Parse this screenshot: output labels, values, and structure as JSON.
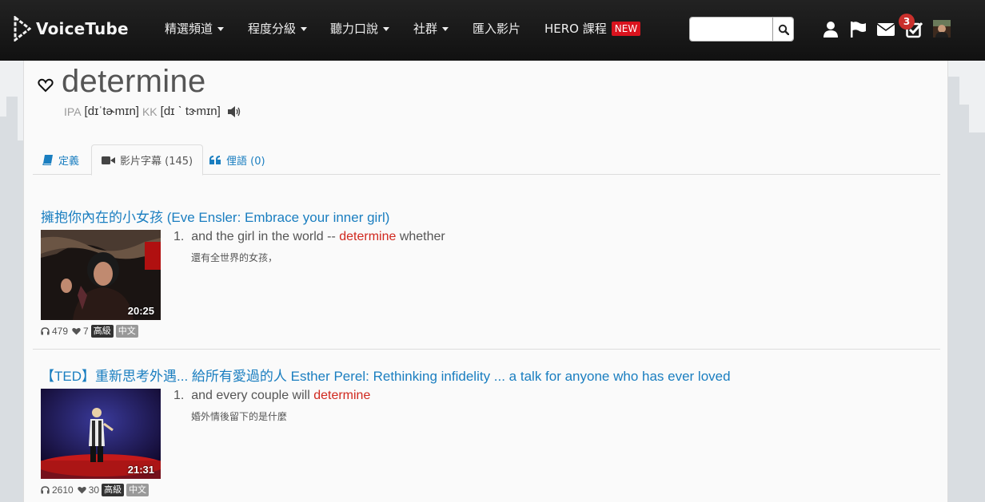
{
  "nav": {
    "logo_text": "VoiceTube",
    "items": [
      {
        "label": "精選頻道",
        "dropdown": true
      },
      {
        "label": "程度分級",
        "dropdown": true
      },
      {
        "label": "聽力口說",
        "dropdown": true
      },
      {
        "label": "社群",
        "dropdown": true
      },
      {
        "label": "匯入影片",
        "dropdown": false
      },
      {
        "label": "HERO 課程",
        "dropdown": false,
        "badge": "NEW"
      }
    ],
    "search_placeholder": "",
    "notification_count": "3",
    "icons": [
      "user-icon",
      "flag-icon",
      "envelope-icon",
      "checkbox-icon",
      "avatar"
    ]
  },
  "word": {
    "title": "determine",
    "ipa_label": "IPA",
    "ipa": "[dɪˈtɚmɪn]",
    "kk_label": "KK",
    "kk": "[dɪ ˋ tɝmɪn]"
  },
  "tabs": [
    {
      "label": "定義",
      "icon": "book-icon",
      "active": false
    },
    {
      "label": "影片字幕 (145)",
      "icon": "video-camera-icon",
      "active": true
    },
    {
      "label": "俚語 (0)",
      "icon": "quote-icon",
      "active": false
    }
  ],
  "entries": [
    {
      "title": "擁抱你內在的小女孩 (Eve Ensler: Embrace your inner girl)",
      "duration": "20:25",
      "listens": "479",
      "likes": "7",
      "level": "高級",
      "lang": "中文",
      "line_num": "1.",
      "line_pre": "and the girl in the world -- ",
      "line_hl": "determine",
      "line_post": " whether",
      "line_zh": "還有全世界的女孩，"
    },
    {
      "title": "【TED】重新思考外遇... 給所有愛過的人 Esther Perel: Rethinking infidelity ... a talk for anyone who has ever loved",
      "duration": "21:31",
      "listens": "2610",
      "likes": "30",
      "level": "高級",
      "lang": "中文",
      "line_num": "1.",
      "line_pre": "and every couple will ",
      "line_hl": "determine",
      "line_post": "",
      "line_zh": "婚外情後留下的是什麼"
    }
  ],
  "colors": {
    "link": "#1a7ec0",
    "highlight": "#d0281e",
    "nav_bg": "#1a1a1a",
    "new_badge": "#d9131e",
    "notif_badge": "#c9302c"
  }
}
